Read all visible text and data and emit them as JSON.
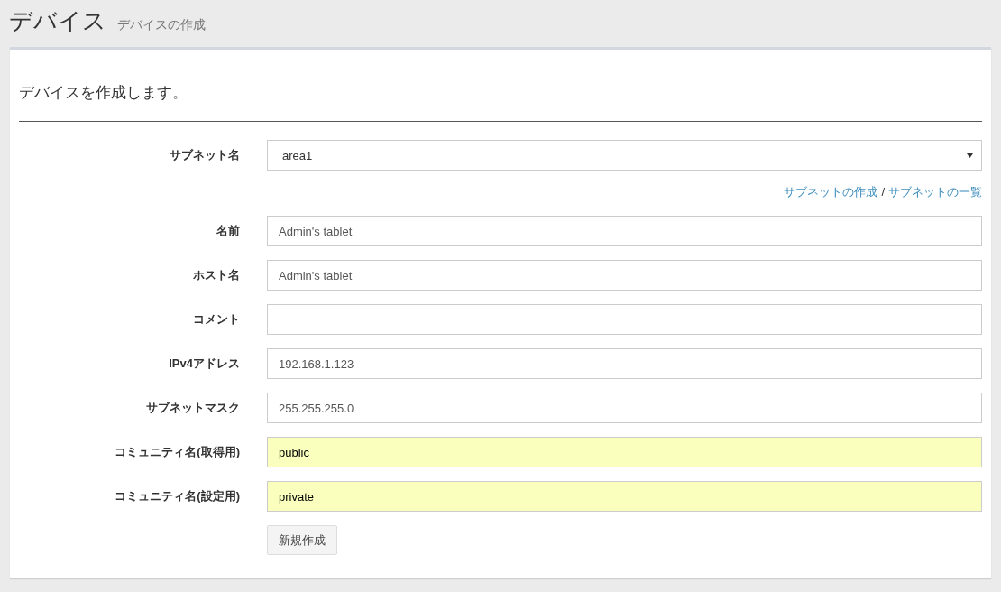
{
  "page_header": {
    "title": "デバイス",
    "subtitle": "デバイスの作成"
  },
  "form": {
    "heading": "デバイスを作成します。",
    "fields": [
      {
        "kind": "select",
        "label": "サブネット名",
        "value": "area1",
        "links": [
          "サブネットの作成",
          "サブネットの一覧"
        ],
        "link_separator": "/"
      },
      {
        "kind": "text",
        "label": "名前",
        "value": "Admin's tablet",
        "autofilled": false
      },
      {
        "kind": "text",
        "label": "ホスト名",
        "value": "Admin's tablet",
        "autofilled": false
      },
      {
        "kind": "text",
        "label": "コメント",
        "autofilled": false
      },
      {
        "kind": "text",
        "label": "IPv4アドレス",
        "value": "192.168.1.123",
        "autofilled": false
      },
      {
        "kind": "text",
        "label": "サブネットマスク",
        "value": "255.255.255.0",
        "autofilled": false
      },
      {
        "kind": "text",
        "label": "コミュニティ名(取得用)",
        "value": "public",
        "autofilled": true
      },
      {
        "kind": "text",
        "label": "コミュニティ名(設定用)",
        "value": "private",
        "autofilled": true
      }
    ],
    "submit_button": "新規作成"
  }
}
